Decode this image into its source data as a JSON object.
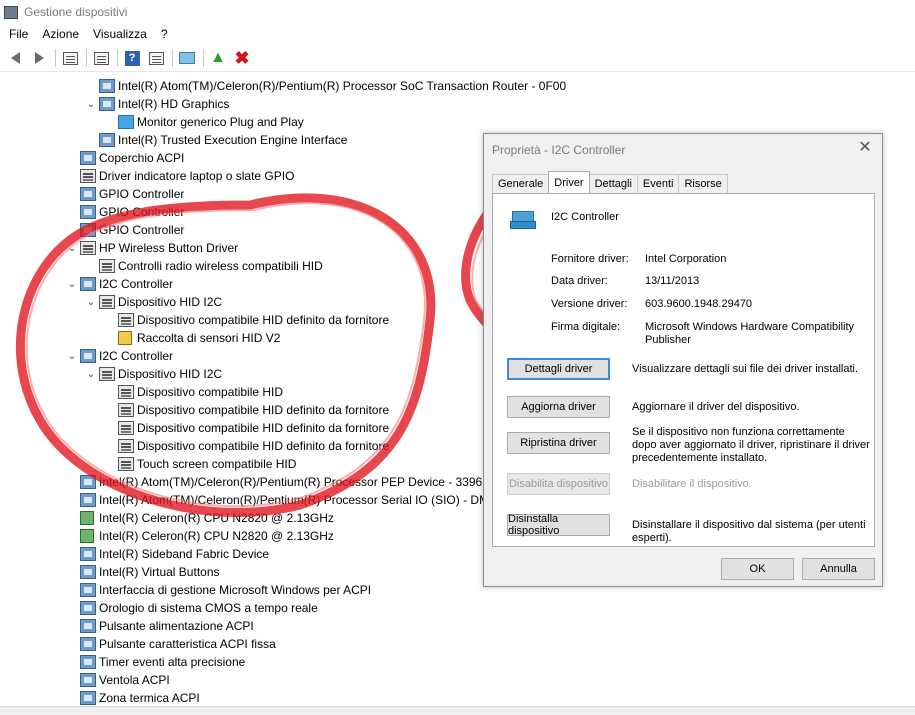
{
  "window": {
    "title": "Gestione dispositivi"
  },
  "menu": [
    "File",
    "Azione",
    "Visualizza",
    "?"
  ],
  "toolbar": {
    "icons": [
      "back-arrow-icon",
      "forward-arrow-icon",
      "properties-icon",
      "show-hide-icon",
      "help-icon",
      "action-icon",
      "monitor-icon",
      "update-driver-icon",
      "uninstall-icon"
    ],
    "uninstall_glyph": "✖",
    "help_glyph": "?",
    "update_glyph": "▲"
  },
  "tree": [
    {
      "label": "Intel(R) Atom(TM)/Celeron(R)/Pentium(R) Processor SoC Transaction Router  - 0F00",
      "level": 1,
      "icon": "dev"
    },
    {
      "label": "Intel(R) HD Graphics",
      "level": 1,
      "icon": "dev",
      "expanded": true
    },
    {
      "label": "Monitor generico Plug and Play",
      "level": 2,
      "icon": "screen"
    },
    {
      "label": "Intel(R) Trusted Execution Engine Interface",
      "level": 1,
      "icon": "dev"
    },
    {
      "label": "Coperchio ACPI",
      "level": 0,
      "icon": "dev"
    },
    {
      "label": "Driver indicatore laptop o slate GPIO",
      "level": 0,
      "icon": "hid"
    },
    {
      "label": "GPIO Controller",
      "level": 0,
      "icon": "dev"
    },
    {
      "label": "GPIO Controller",
      "level": 0,
      "icon": "dev"
    },
    {
      "label": "GPIO Controller",
      "level": 0,
      "icon": "dev"
    },
    {
      "label": "HP Wireless Button Driver",
      "level": 0,
      "icon": "hid",
      "expanded": true
    },
    {
      "label": "Controlli radio wireless compatibili HID",
      "level": 1,
      "icon": "hid"
    },
    {
      "label": "I2C Controller",
      "level": 0,
      "icon": "dev",
      "expanded": true
    },
    {
      "label": "Dispositivo HID I2C",
      "level": 1,
      "icon": "hid",
      "expanded": true
    },
    {
      "label": "Dispositivo compatibile HID definito da fornitore",
      "level": 2,
      "icon": "hid"
    },
    {
      "label": "Raccolta di sensori HID V2",
      "level": 2,
      "icon": "sensor"
    },
    {
      "label": "I2C Controller",
      "level": 0,
      "icon": "dev",
      "expanded": true
    },
    {
      "label": "Dispositivo HID I2C",
      "level": 1,
      "icon": "hid",
      "expanded": true
    },
    {
      "label": "Dispositivo compatibile HID",
      "level": 2,
      "icon": "hid"
    },
    {
      "label": "Dispositivo compatibile HID definito da fornitore",
      "level": 2,
      "icon": "hid"
    },
    {
      "label": "Dispositivo compatibile HID definito da fornitore",
      "level": 2,
      "icon": "hid"
    },
    {
      "label": "Dispositivo compatibile HID definito da fornitore",
      "level": 2,
      "icon": "hid"
    },
    {
      "label": "Touch screen compatibile HID",
      "level": 2,
      "icon": "hid"
    },
    {
      "label": "Intel(R) Atom(TM)/Celeron(R)/Pentium(R) Processor PEP Device - 3396",
      "level": 0,
      "icon": "dev"
    },
    {
      "label": "Intel(R) Atom(TM)/Celeron(R)/Pentium(R) Processor Serial IO (SIO) - DM",
      "level": 0,
      "icon": "dev"
    },
    {
      "label": "Intel(R) Celeron(R) CPU  N2820  @ 2.13GHz",
      "level": 0,
      "icon": "cpu"
    },
    {
      "label": "Intel(R) Celeron(R) CPU  N2820  @ 2.13GHz",
      "level": 0,
      "icon": "cpu"
    },
    {
      "label": "Intel(R) Sideband Fabric Device",
      "level": 0,
      "icon": "dev"
    },
    {
      "label": "Intel(R) Virtual Buttons",
      "level": 0,
      "icon": "dev"
    },
    {
      "label": "Interfaccia di gestione Microsoft Windows per ACPI",
      "level": 0,
      "icon": "dev"
    },
    {
      "label": "Orologio di sistema CMOS a tempo reale",
      "level": 0,
      "icon": "dev"
    },
    {
      "label": "Pulsante alimentazione ACPI",
      "level": 0,
      "icon": "dev"
    },
    {
      "label": "Pulsante caratteristica ACPI fissa",
      "level": 0,
      "icon": "dev"
    },
    {
      "label": "Timer eventi alta precisione",
      "level": 0,
      "icon": "dev"
    },
    {
      "label": "Ventola ACPI",
      "level": 0,
      "icon": "dev"
    },
    {
      "label": "Zona termica ACPI",
      "level": 0,
      "icon": "dev"
    }
  ],
  "dialog": {
    "title": "Proprietà - I2C Controller",
    "close_glyph": "✕",
    "tabs": [
      "Generale",
      "Driver",
      "Dettagli",
      "Eventi",
      "Risorse"
    ],
    "active_tab": "Driver",
    "device_name": "I2C Controller",
    "properties": [
      {
        "label": "Fornitore driver:",
        "value": "Intel Corporation"
      },
      {
        "label": "Data driver:",
        "value": "13/11/2013"
      },
      {
        "label": "Versione driver:",
        "value": "603.9600.1948.29470"
      },
      {
        "label": "Firma digitale:",
        "value": "Microsoft Windows Hardware Compatibility Publisher"
      }
    ],
    "actions": [
      {
        "button": "Dettagli driver",
        "desc": "Visualizzare dettagli sui file dei driver installati.",
        "disabled": false
      },
      {
        "button": "Aggiorna driver",
        "desc": "Aggiornare il driver del dispositivo.",
        "disabled": false
      },
      {
        "button": "Ripristina driver",
        "desc": "Se il dispositivo non funziona correttamente dopo aver aggiornato il driver, ripristinare il driver precedentemente installato.",
        "disabled": false
      },
      {
        "button": "Disabilita dispositivo",
        "desc": "Disabilitare il dispositivo.",
        "disabled": true
      },
      {
        "button": "Disinstalla dispositivo",
        "desc": "Disinstallare il dispositivo dal sistema (per utenti esperti).",
        "disabled": false
      }
    ],
    "ok_label": "OK",
    "cancel_label": "Annulla"
  },
  "colors": {
    "scribble": "#e0141e",
    "accent": "#3c8dd5"
  }
}
